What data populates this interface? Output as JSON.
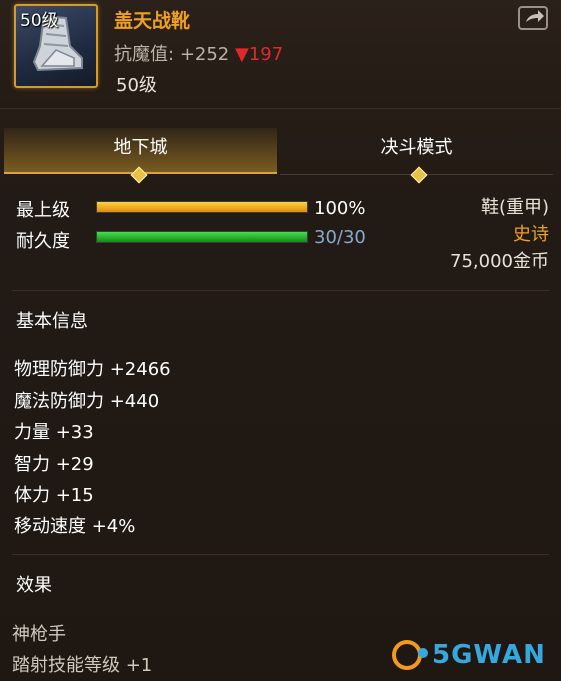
{
  "item": {
    "level_badge": "50级",
    "name": "盖天战靴",
    "resist_label": "抗魔值:",
    "resist_value": "+252",
    "resist_down": "▼197",
    "required_level": "50级",
    "icon": "armored-boot-icon"
  },
  "tabs": [
    {
      "label": "地下城",
      "active": true
    },
    {
      "label": "决斗模式",
      "active": false
    }
  ],
  "bars": {
    "max_level": {
      "label": "最上级",
      "value_text": "100%",
      "fill": 1.0,
      "color": "#f0a020"
    },
    "durability": {
      "label": "耐久度",
      "value_text": "30/30",
      "fill": 1.0,
      "color": "#2dc52f"
    }
  },
  "meta": {
    "type": "鞋(重甲)",
    "rarity": "史诗",
    "price": "75,000金币"
  },
  "basic_info": {
    "title": "基本信息",
    "attributes": [
      "物理防御力 +2466",
      "魔法防御力 +440",
      "力量 +33",
      "智力 +29",
      "体力 +15",
      "移动速度 +4%"
    ]
  },
  "effects": {
    "title": "效果",
    "lines": [
      "神枪手",
      "踏射技能等级 +1"
    ]
  },
  "watermark": "5GWAN",
  "colors": {
    "accent_gold": "#f0a020",
    "resist_down": "#e3282d",
    "durability_value": "#88a9cf"
  }
}
